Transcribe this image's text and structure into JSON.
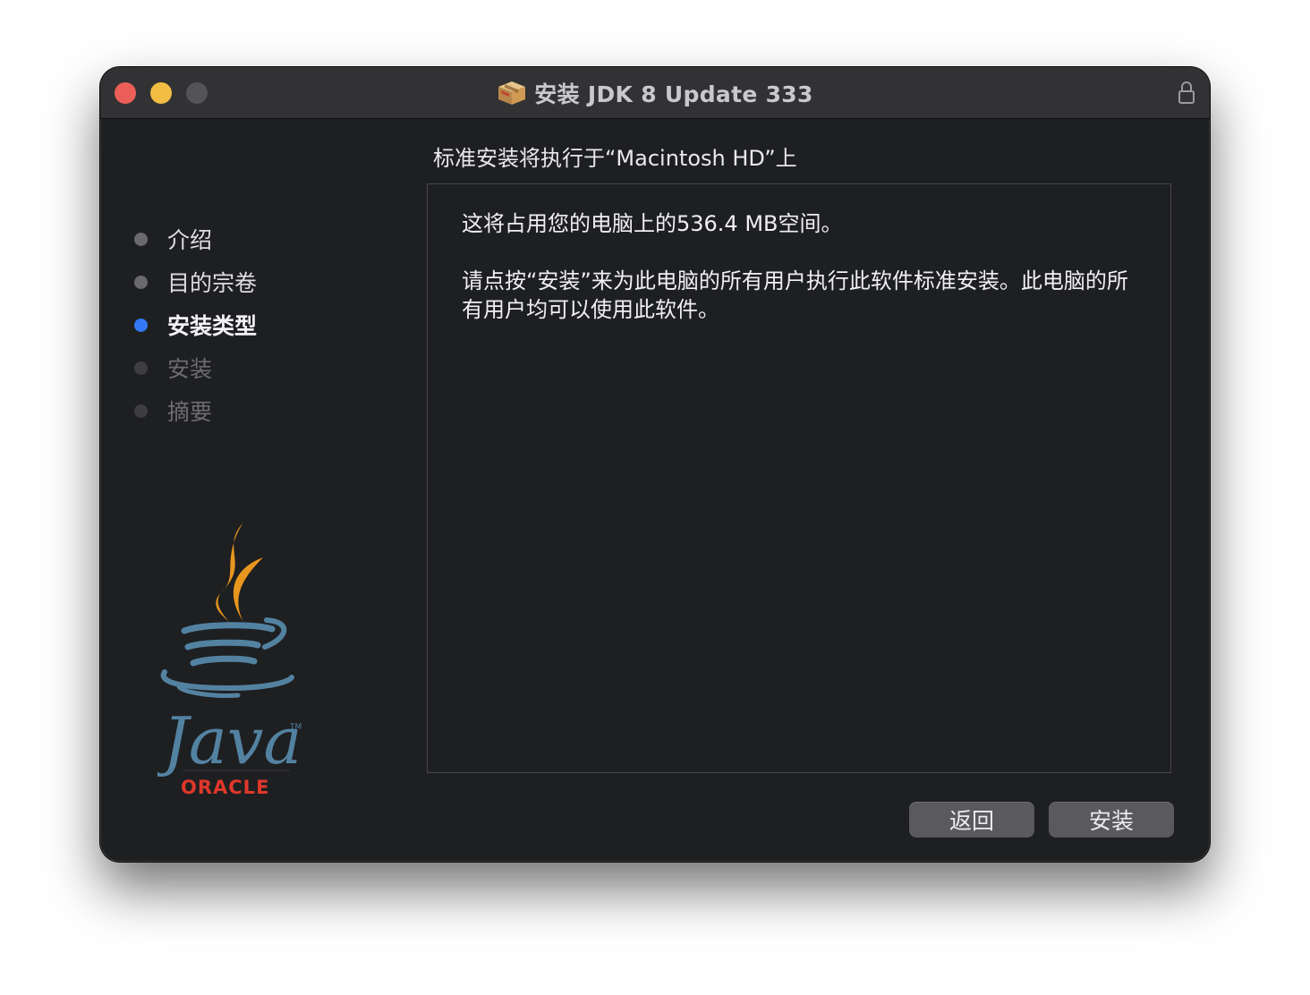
{
  "window": {
    "title": "安装 JDK 8 Update 333",
    "title_icon": "package-box-icon",
    "lock_icon": "lock-icon"
  },
  "content": {
    "heading": "标准安装将执行于“Macintosh HD”上",
    "space_message": "这将占用您的电脑上的536.4 MB空间。",
    "install_message": "请点按“安装”来为此电脑的所有用户执行此软件标准安装。此电脑的所有用户均可以使用此软件。"
  },
  "sidebar": {
    "steps": [
      {
        "label": "介绍",
        "state": "done"
      },
      {
        "label": "目的宗卷",
        "state": "done"
      },
      {
        "label": "安装类型",
        "state": "active"
      },
      {
        "label": "安装",
        "state": "pending"
      },
      {
        "label": "摘要",
        "state": "pending"
      }
    ],
    "logo": {
      "wordmark": "Java",
      "vendor": "ORACLE",
      "trademark": "TM"
    }
  },
  "buttons": {
    "back_label": "返回",
    "install_label": "安装"
  },
  "colors": {
    "window_bg": "#1e1f21",
    "titlebar_bg": "#323234",
    "active_step": "#3478f6",
    "close": "#ec5f58",
    "minimize": "#f2bd43",
    "java_orange": "#e8961e",
    "java_blue": "#5382a1",
    "oracle_red": "#e0382b"
  }
}
